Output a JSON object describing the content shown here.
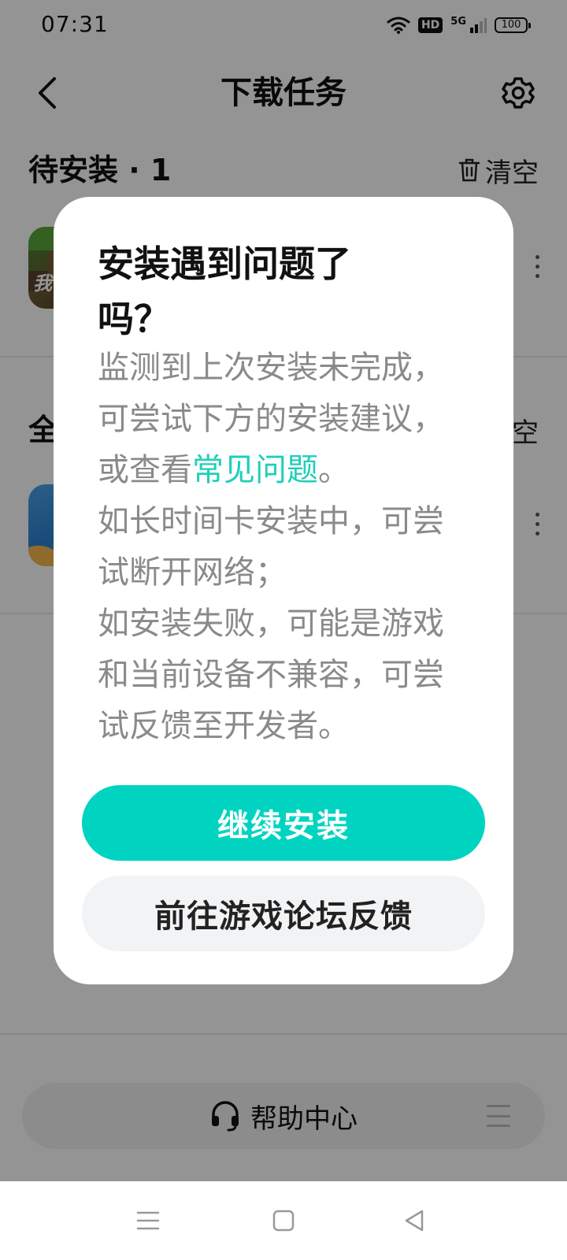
{
  "status_bar": {
    "time": "07:31",
    "hd_label": "HD",
    "network_label": "5G",
    "battery": "100",
    "icons": [
      "wifi-icon",
      "hd-icon",
      "signal-icon",
      "battery-icon"
    ]
  },
  "header": {
    "title": "下载任务",
    "back_icon": "chevron-left-icon",
    "settings_icon": "gear-icon"
  },
  "pending_section": {
    "title": "待安装 · 1",
    "clear_label": "清空",
    "clear_icon": "trash-icon"
  },
  "all_section": {
    "title": "全",
    "clear_label": "空"
  },
  "apps": [
    {
      "icon_text": "我",
      "more_icon": "more-vertical-icon"
    },
    {
      "icon_text": "",
      "more_icon": "more-vertical-icon"
    }
  ],
  "help": {
    "label": "帮助中心",
    "icon": "headset-icon",
    "menu_icon": "menu-icon"
  },
  "dialog": {
    "title": "安装遇到问题了吗？",
    "body_line1_prefix": "监测到上次安装未完成，可尝试下方的安装建议，或查看",
    "faq_link": "常见问题",
    "body_line1_suffix": "。",
    "body_line2": "如长时间卡安装中，可尝试断开网络；",
    "body_line3": "如安装失败，可能是游戏和当前设备不兼容，可尝试反馈至开发者。",
    "primary_button": "继续安装",
    "secondary_button": "前往游戏论坛反馈"
  },
  "nav_bar": {
    "icons": [
      "menu-icon",
      "home-square-icon",
      "back-triangle-icon"
    ]
  },
  "colors": {
    "accent": "#00d4c1",
    "link": "#1fcfba",
    "overlay": "rgba(0,0,0,0.42)"
  }
}
